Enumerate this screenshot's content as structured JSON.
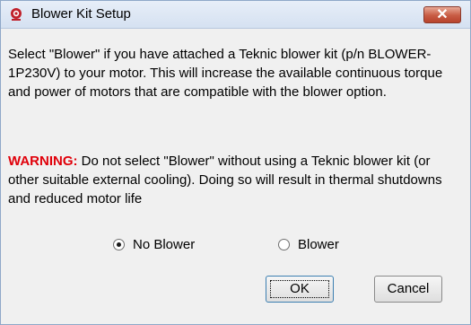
{
  "window": {
    "title": "Blower Kit Setup",
    "close_glyph": "✕",
    "icon": "app-icon"
  },
  "description": "Select \"Blower\" if you have attached a Teknic blower kit (p/n BLOWER-1P230V) to your motor. This will increase the available continuous torque and power of motors that are compatible with the blower option.",
  "warning": {
    "label": "WARNING:",
    "text": " Do not select \"Blower\" without using a Teknic blower kit (or other suitable external cooling). Doing so will result in thermal shutdowns and reduced motor life"
  },
  "options": [
    {
      "label": "No Blower",
      "selected": true
    },
    {
      "label": "Blower",
      "selected": false
    }
  ],
  "buttons": {
    "ok": "OK",
    "cancel": "Cancel"
  },
  "colors": {
    "warning": "#e0000a",
    "close": "#c75b43"
  }
}
